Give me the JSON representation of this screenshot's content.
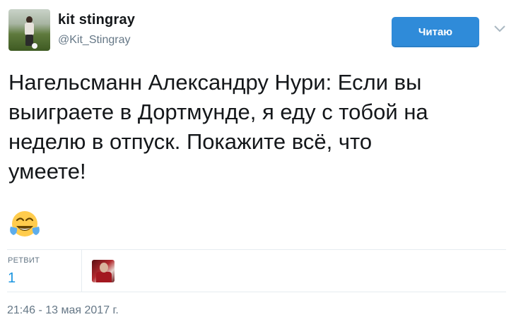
{
  "user": {
    "name": "kit stingray",
    "handle": "@Kit_Stingray"
  },
  "follow_button": {
    "label": "Читаю"
  },
  "tweet": {
    "text": "Нагельсманн Александру Нури: Если вы\nвыиграете в Дортмунде, я еду с тобой на\nнеделю в отпуск. Покажите всё, что\nумеете!",
    "emoji": "face-with-tears-of-joy"
  },
  "stats": {
    "retweet_label": "РЕТВИТ",
    "retweet_count": "1"
  },
  "timestamp": "21:46 - 13 мая 2017 г.",
  "colors": {
    "accent": "#1b95e0",
    "button": "#2f8bd9",
    "secondary_text": "#657786",
    "primary_text": "#14171a",
    "divider": "#e6ecf0"
  },
  "icons": {
    "menu": "chevron-down-icon",
    "emoji": "face-with-tears-of-joy-icon"
  }
}
